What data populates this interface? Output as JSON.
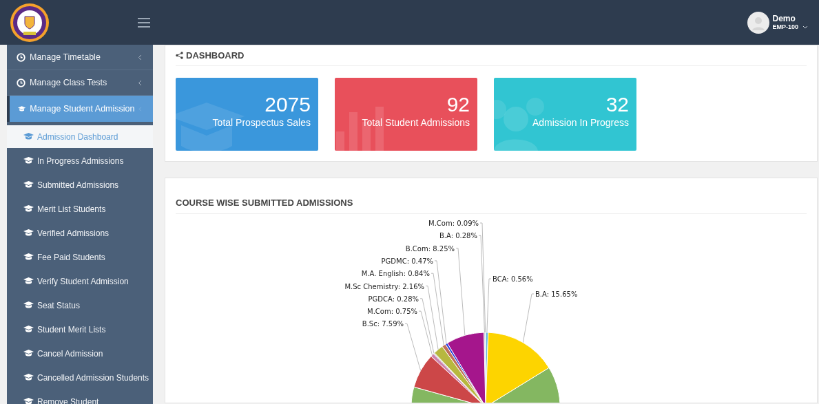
{
  "header": {
    "user": {
      "name": "Demo",
      "id": "EMP-100"
    }
  },
  "sidebar": {
    "items": [
      {
        "label": "Manage Timetable",
        "kind": "clock",
        "selected": false,
        "expanded": false
      },
      {
        "label": "Manage Class Tests",
        "kind": "clock",
        "selected": false,
        "expanded": false
      },
      {
        "label": "Manage Student Admission",
        "kind": "cap",
        "selected": true,
        "expanded": true,
        "children": [
          {
            "label": "Admission Dashboard",
            "selected": true
          },
          {
            "label": "In Progress Admissions",
            "selected": false
          },
          {
            "label": "Submitted Admissions",
            "selected": false
          },
          {
            "label": "Merit List Students",
            "selected": false
          },
          {
            "label": "Verified Admissions",
            "selected": false
          },
          {
            "label": "Fee Paid Students",
            "selected": false
          },
          {
            "label": "Verify Student Admission",
            "selected": false
          },
          {
            "label": "Seat Status",
            "selected": false
          },
          {
            "label": "Student Merit Lists",
            "selected": false
          },
          {
            "label": "Cancel Admission",
            "selected": false
          },
          {
            "label": "Cancelled Admission Students",
            "selected": false
          },
          {
            "label": "Remove Student",
            "selected": false
          }
        ]
      }
    ]
  },
  "dashboard": {
    "title": "DASHBOARD",
    "cards": [
      {
        "value": "2075",
        "label": "Total Prospectus Sales",
        "kind": "cap",
        "color": "#3a97dc"
      },
      {
        "value": "92",
        "label": "Total Student Admissions",
        "kind": "bars",
        "color": "#e8505b"
      },
      {
        "value": "32",
        "label": "Admission In Progress",
        "kind": "people",
        "color": "#31c5d2"
      }
    ]
  },
  "course_chart": {
    "title": "COURSE WISE SUBMITTED ADMISSIONS",
    "slice_labels": [
      {
        "text": "BCA: 0.56%",
        "color": "#67b7dc"
      },
      {
        "text": "B.A: 15.65%",
        "color": "#fdd400"
      },
      {
        "text": "M.Com: 0.09%"
      },
      {
        "text": "B.A: 0.28%"
      },
      {
        "text": "B.Com: 8.25%",
        "color": "#a5168c"
      },
      {
        "text": "PGDMC: 0.47%",
        "color": "#2a3fe0"
      },
      {
        "text": "M.A. English: 0.84%",
        "color": "#c0705a"
      },
      {
        "text": "M.Sc Chemistry: 2.16%",
        "color": "#b7b83f"
      },
      {
        "text": "PGDCA: 0.28%"
      },
      {
        "text": "M.Com: 0.75%",
        "color": "#cd82ad"
      },
      {
        "text": "B.Sc: 7.59%",
        "color": "#cc4748"
      }
    ]
  }
}
